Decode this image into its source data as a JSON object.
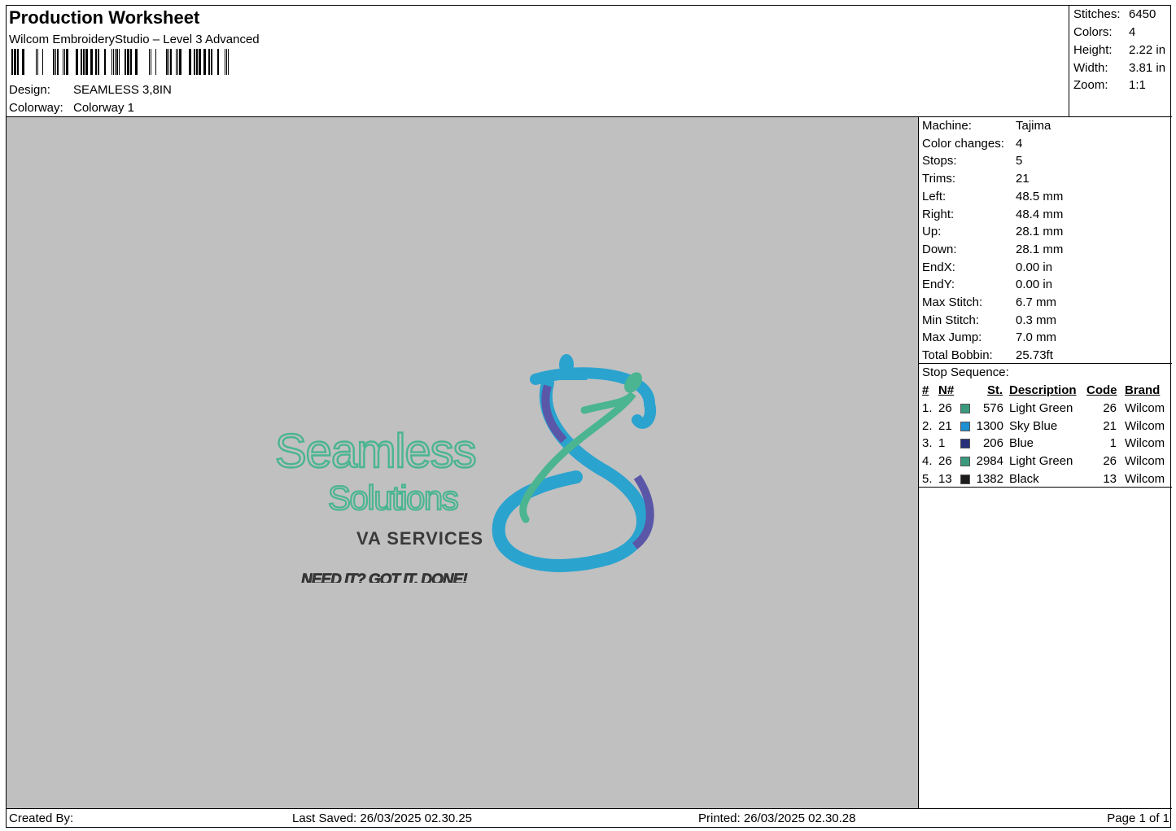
{
  "header": {
    "title": "Production Worksheet",
    "software": "Wilcom EmbroideryStudio – Level 3 Advanced",
    "design_label": "Design:",
    "design_value": "SEAMLESS 3,8IN",
    "colorway_label": "Colorway:",
    "colorway_value": "Colorway 1"
  },
  "summary": {
    "stitches_label": "Stitches:",
    "stitches": "6450",
    "colors_label": "Colors:",
    "colors": "4",
    "height_label": "Height:",
    "height": "2.22 in",
    "width_label": "Width:",
    "width": "3.81 in",
    "zoom_label": "Zoom:",
    "zoom": "1:1"
  },
  "logo": {
    "line1": "Seamless",
    "line2": "Solutions",
    "line3": "VA SERVICES",
    "tagline": "NEED IT? GOT IT. DONE!"
  },
  "specs": [
    {
      "label": "Machine:",
      "value": "Tajima"
    },
    {
      "label": "Color changes:",
      "value": "4"
    },
    {
      "label": "Stops:",
      "value": "5"
    },
    {
      "label": "Trims:",
      "value": "21"
    },
    {
      "label": "Left:",
      "value": "48.5 mm"
    },
    {
      "label": "Right:",
      "value": "48.4 mm"
    },
    {
      "label": "Up:",
      "value": "28.1 mm"
    },
    {
      "label": "Down:",
      "value": "28.1 mm"
    },
    {
      "label": "EndX:",
      "value": "0.00 in"
    },
    {
      "label": "EndY:",
      "value": "0.00 in"
    },
    {
      "label": "Max Stitch:",
      "value": "6.7 mm"
    },
    {
      "label": "Min Stitch:",
      "value": "0.3 mm"
    },
    {
      "label": "Max Jump:",
      "value": "7.0 mm"
    },
    {
      "label": "Total Bobbin:",
      "value": "25.73ft"
    }
  ],
  "stop_sequence": {
    "heading": "Stop Sequence:",
    "columns": {
      "num": "#",
      "n": "N#",
      "st": "St.",
      "desc": "Description",
      "code": "Code",
      "brand": "Brand"
    },
    "rows": [
      {
        "num": "1.",
        "n": "26",
        "color": "#3a9a7e",
        "st": "576",
        "desc": "Light Green",
        "code": "26",
        "brand": "Wilcom"
      },
      {
        "num": "2.",
        "n": "21",
        "color": "#1e8fd0",
        "st": "1300",
        "desc": "Sky Blue",
        "code": "21",
        "brand": "Wilcom"
      },
      {
        "num": "3.",
        "n": "1",
        "color": "#26307a",
        "st": "206",
        "desc": "Blue",
        "code": "1",
        "brand": "Wilcom"
      },
      {
        "num": "4.",
        "n": "26",
        "color": "#3a9a7e",
        "st": "2984",
        "desc": "Light Green",
        "code": "26",
        "brand": "Wilcom"
      },
      {
        "num": "5.",
        "n": "13",
        "color": "#1c1c1c",
        "st": "1382",
        "desc": "Black",
        "code": "13",
        "brand": "Wilcom"
      }
    ]
  },
  "footer": {
    "created_by": "Created By:",
    "last_saved": "Last Saved: 26/03/2025 02.30.25",
    "printed": "Printed: 26/03/2025 02.30.28",
    "page": "Page 1 of 1"
  },
  "colors": {
    "canvas": "#c0c0c0",
    "logo_green": "#4ab590",
    "logo_blue": "#2aa3cf",
    "logo_purple": "#5a56a8",
    "logo_dark": "#3a3a3a"
  }
}
